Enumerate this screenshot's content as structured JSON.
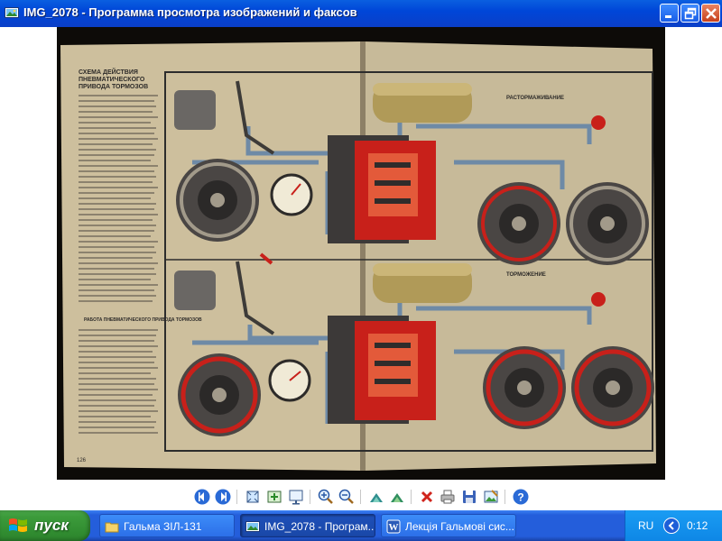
{
  "window": {
    "title": "IMG_2078 - Программа просмотра изображений и факсов",
    "icon": "image-viewer-icon"
  },
  "window_controls": [
    "minimize-icon",
    "maximize-icon",
    "close-icon"
  ],
  "image": {
    "heading_lines": [
      "СХЕМА ДЕЙСТВИЯ",
      "ПНЕВМАТИЧЕСКОГО",
      "ПРИВОДА ТОРМОЗОВ"
    ],
    "top_label": "РАСТОРМАЖИВАНИЕ",
    "bottom_label": "ТОРМОЖЕНИЕ",
    "section_heading": "РАБОТА ПНЕВМАТИЧЕСКОГО ПРИВОДА ТОРМОЗОВ",
    "page_number": "126",
    "colors": {
      "paper": "#c9bea0",
      "tank": "#b09a58",
      "pipe": "#6e8aa6",
      "red": "#c8201a",
      "drum": "#4a4644"
    }
  },
  "toolbar": {
    "buttons": [
      {
        "name": "previous-image-button",
        "icon": "previous-icon"
      },
      {
        "name": "next-image-button",
        "icon": "next-icon"
      },
      {
        "name": "best-fit-button",
        "icon": "best-fit-icon"
      },
      {
        "name": "actual-size-button",
        "icon": "actual-size-icon"
      },
      {
        "name": "slideshow-button",
        "icon": "slideshow-icon"
      },
      {
        "name": "zoom-in-button",
        "icon": "zoom-in-icon"
      },
      {
        "name": "zoom-out-button",
        "icon": "zoom-out-icon"
      },
      {
        "name": "rotate-clockwise-button",
        "icon": "rotate-clockwise-icon"
      },
      {
        "name": "rotate-counterclockwise-button",
        "icon": "rotate-counterclockwise-icon"
      },
      {
        "name": "delete-button",
        "icon": "delete-icon"
      },
      {
        "name": "print-button",
        "icon": "print-icon"
      },
      {
        "name": "save-button",
        "icon": "save-icon"
      },
      {
        "name": "edit-button",
        "icon": "edit-icon"
      },
      {
        "name": "help-button",
        "icon": "help-icon"
      }
    ]
  },
  "taskbar": {
    "start_label": "пуск",
    "tasks": [
      {
        "label": "Гальма ЗІЛ-131",
        "icon": "folder-icon",
        "active": false
      },
      {
        "label": "IMG_2078 - Програм...",
        "icon": "image-viewer-icon",
        "active": true
      },
      {
        "label": "Лекція Гальмові сис...",
        "icon": "word-icon",
        "active": false
      }
    ],
    "language": "RU",
    "clock": "0:12"
  }
}
